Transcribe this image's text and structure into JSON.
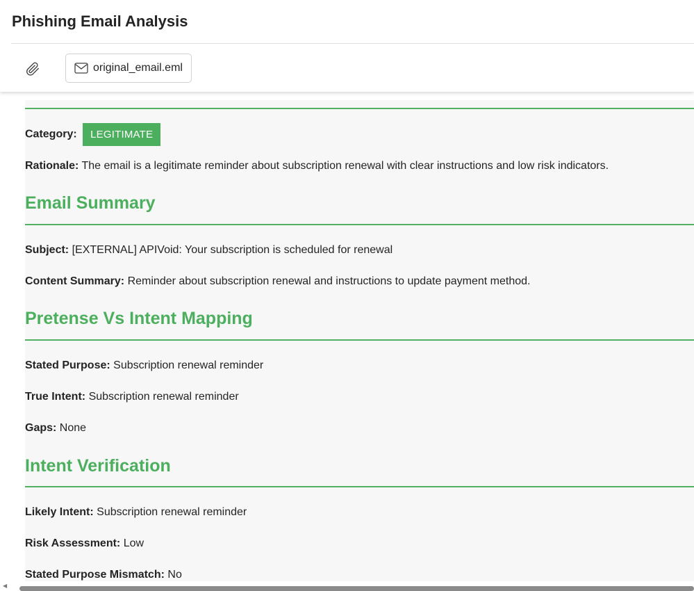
{
  "header": {
    "title": "Phishing Email Analysis",
    "attachment_icon": "paperclip-icon",
    "file_icon": "envelope-icon",
    "file_name": "original_email.eml"
  },
  "classification": {
    "category_label": "Category:",
    "category_value": "LEGITIMATE",
    "rationale_label": "Rationale:",
    "rationale_value": "The email is a legitimate reminder about subscription renewal with clear instructions and low risk indicators."
  },
  "email_summary": {
    "title": "Email Summary",
    "subject_label": "Subject:",
    "subject_value": "[EXTERNAL] APIVoid: Your subscription is scheduled for renewal",
    "content_label": "Content Summary:",
    "content_value": "Reminder about subscription renewal and instructions to update payment method."
  },
  "pretense": {
    "title": "Pretense Vs Intent Mapping",
    "stated_label": "Stated Purpose:",
    "stated_value": "Subscription renewal reminder",
    "true_label": "True Intent:",
    "true_value": "Subscription renewal reminder",
    "gaps_label": "Gaps:",
    "gaps_value": "None"
  },
  "intent": {
    "title": "Intent Verification",
    "likely_label": "Likely Intent:",
    "likely_value": "Subscription renewal reminder",
    "risk_label": "Risk Assessment:",
    "risk_value": "Low",
    "mismatch_label": "Stated Purpose Mismatch:",
    "mismatch_value": "No"
  },
  "colors": {
    "accent": "#4caf5e",
    "badge_bg": "#4caf5e",
    "content_bg": "#f7f7f7"
  }
}
